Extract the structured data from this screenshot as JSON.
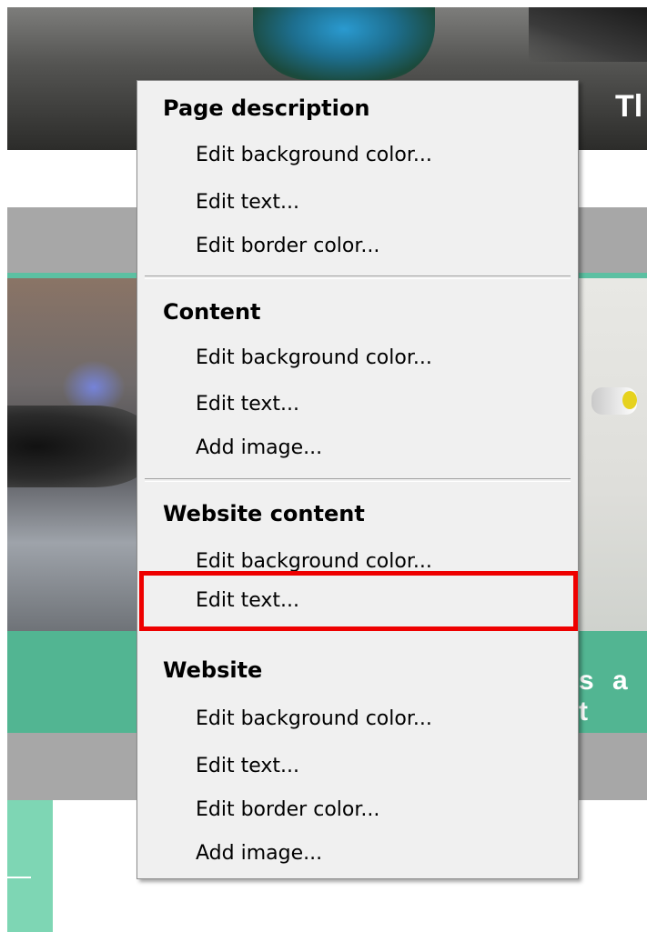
{
  "background": {
    "header_text": "Tl",
    "band_text": "s a t"
  },
  "menu": {
    "sections": [
      {
        "title": "Page description",
        "items": [
          "Edit background color...",
          "Edit text...",
          "Edit border color..."
        ]
      },
      {
        "title": "Content",
        "items": [
          "Edit background color...",
          "Edit text...",
          "Add image..."
        ]
      },
      {
        "title": "Website content",
        "items": [
          "Edit background color...",
          "Edit text..."
        ]
      },
      {
        "title": "Website",
        "items": [
          "Edit background color...",
          "Edit text...",
          "Edit border color...",
          "Add image..."
        ]
      }
    ],
    "highlight_color": "#ee0000"
  }
}
